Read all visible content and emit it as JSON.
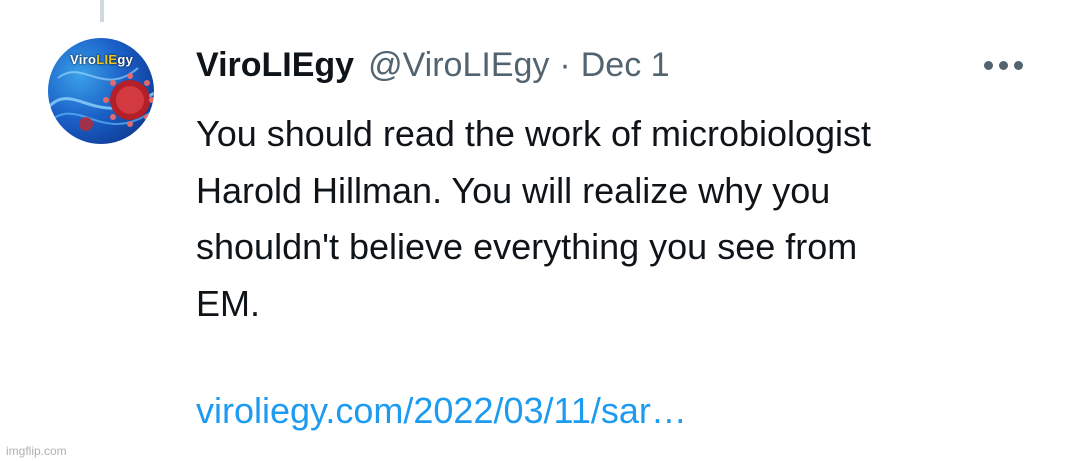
{
  "tweet": {
    "display_name": "ViroLIEgy",
    "handle": "@ViroLIEgy",
    "separator": "·",
    "date": "Dec 1",
    "avatar": {
      "text_start": "Viro",
      "text_highlight": "LIE",
      "text_end": "gy"
    },
    "body_lines": [
      "You should read the work of microbiologist",
      "Harold Hillman. You will realize why you",
      "shouldn't believe everything you see from",
      "EM."
    ],
    "link": "viroliegy.com/2022/03/11/sar…",
    "more_icon": "ellipsis-icon"
  },
  "watermark": "imgflip.com",
  "colors": {
    "text": "#0f1419",
    "secondary": "#536471",
    "link": "#1d9bf0",
    "thread_line": "#cfd9de"
  }
}
